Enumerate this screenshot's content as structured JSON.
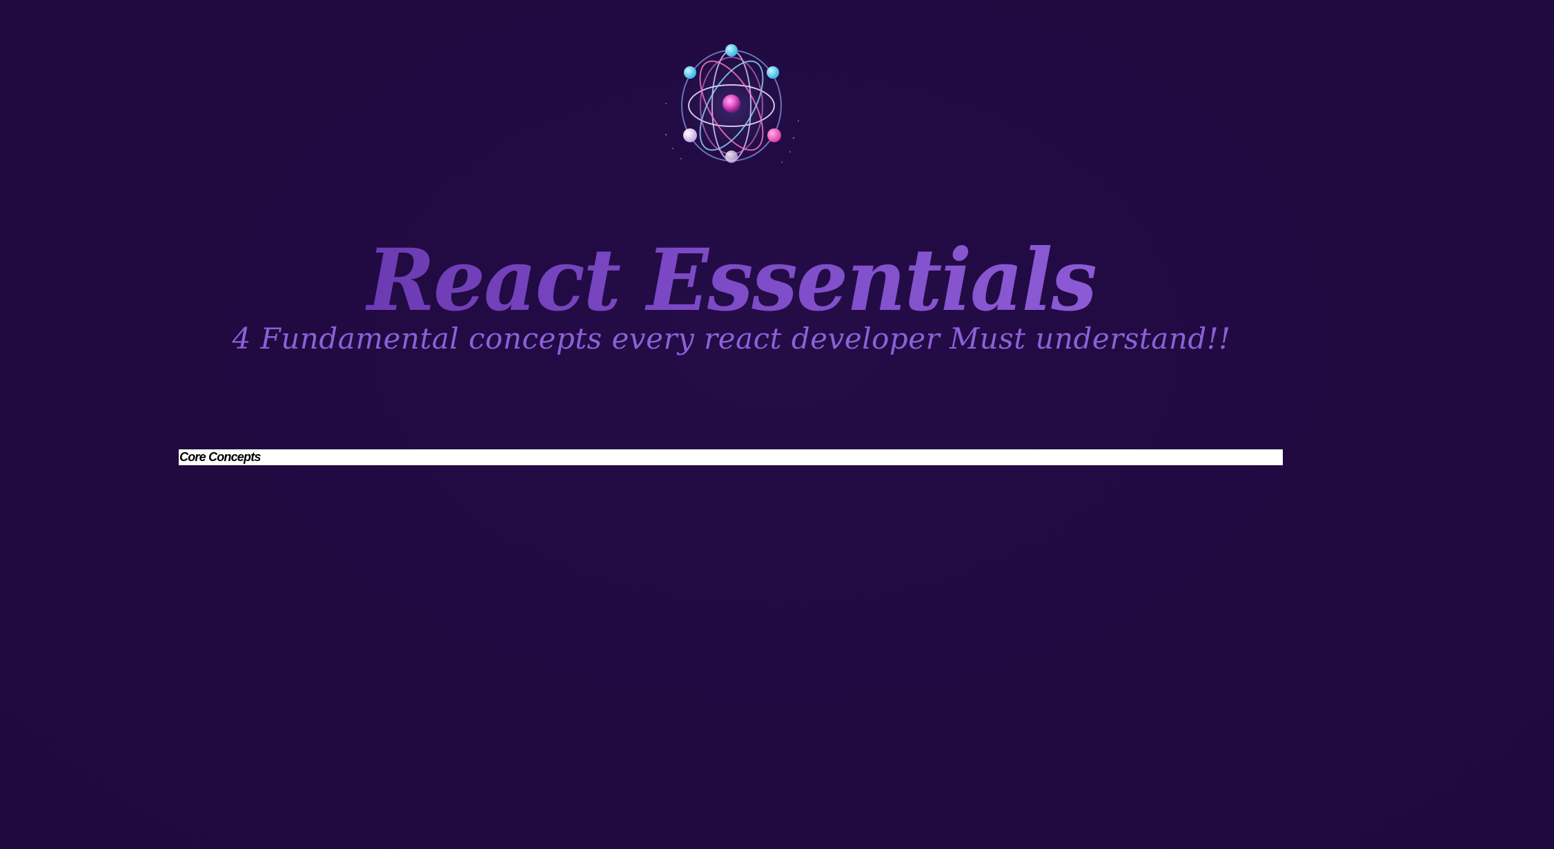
{
  "header": {
    "logo_icon": "react-atom-icon",
    "title": "React Essentials",
    "subtitle": "4 Fundamental concepts every react developer Must understand!!"
  },
  "core_concepts": {
    "heading": "Core Concepts"
  },
  "colors": {
    "background": "#200a40",
    "title_gradient_start": "#5a2a9c",
    "title_gradient_end": "#9a6ae2",
    "subtitle": "#8d60d8",
    "section_background": "#ffffff"
  }
}
